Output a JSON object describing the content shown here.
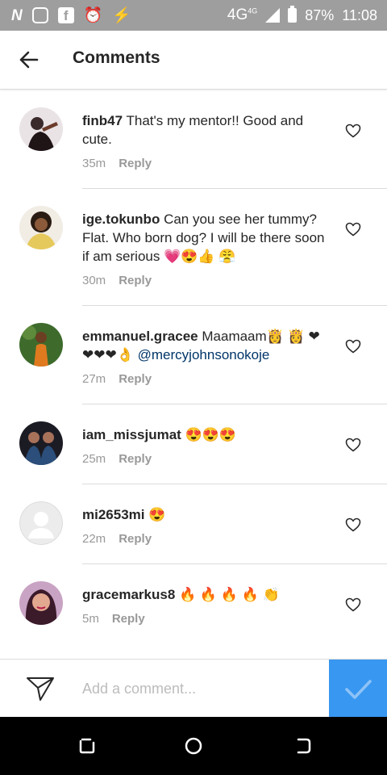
{
  "status_bar": {
    "network": "4G",
    "network_sup": "4G",
    "battery": "87%",
    "time": "11:08",
    "left_icons": [
      "n-logo-icon",
      "instagram-icon",
      "facebook-icon",
      "alarm-icon",
      "usb-icon"
    ]
  },
  "header": {
    "title": "Comments"
  },
  "comments": [
    {
      "username": "finb47",
      "text": "That's my mentor!! Good and cute.",
      "time": "35m",
      "reply": "Reply"
    },
    {
      "username": "ige.tokunbo",
      "text": "Can you see her tummy? Flat. Who born dog? I will be there soon if am serious 💗😍👍 😤",
      "time": "30m",
      "reply": "Reply"
    },
    {
      "username": "emmanuel.gracee",
      "text": "Maamaam👸 👸 ❤❤❤❤👌",
      "mention": "@mercyjohnsonokoje",
      "time": "27m",
      "reply": "Reply"
    },
    {
      "username": "iam_missjumat",
      "text": "😍😍😍",
      "time": "25m",
      "reply": "Reply"
    },
    {
      "username": "mi2653mi",
      "text": "😍",
      "time": "22m",
      "reply": "Reply"
    },
    {
      "username": "gracemarkus8",
      "text": "🔥 🔥 🔥 🔥 👏",
      "time": "5m",
      "reply": "Reply"
    }
  ],
  "composer": {
    "placeholder": "Add a comment..."
  },
  "colors": {
    "accent": "#3897f0",
    "status_bar": "#9e9e9e",
    "text": "#262626",
    "meta": "#999999"
  }
}
